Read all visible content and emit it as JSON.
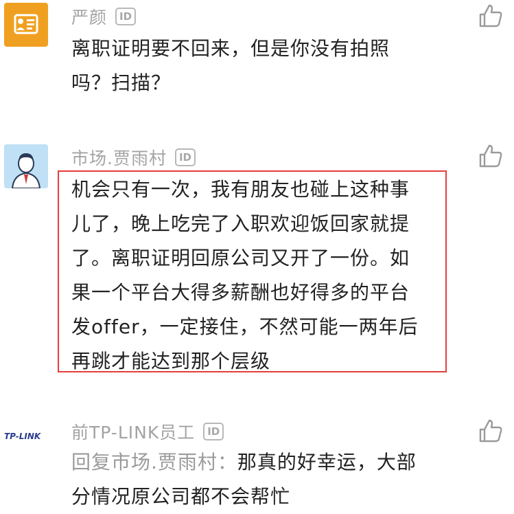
{
  "colors": {
    "accent_orange": "#f0a020",
    "highlight_red": "#e53b3b",
    "username_gray": "#a3a3a3",
    "text_dark": "#222222"
  },
  "comments": [
    {
      "username": "严颜",
      "badge": "ID",
      "avatar_icon": "contact-card-icon",
      "lines": [
        "离职证明要不回来，但是你没有拍照",
        "吗？扫描？"
      ]
    },
    {
      "username": "市场.贾雨村",
      "badge": "ID",
      "avatar_icon": "businessman-avatar-icon",
      "lines": [
        "机会只有一次，我有朋友也碰上这种事",
        "儿了，晚上吃完了入职欢迎饭回家就提",
        "了。离职证明回原公司又开了一份。如",
        "果一个平台大得多薪酬也好得多的平台",
        "发offer，一定接住，不然可能一两年后",
        "再跳才能达到那个层级"
      ]
    },
    {
      "username": "前TP-LINK员工",
      "badge": "ID",
      "avatar_logo_text": "TP-LINK",
      "reply_prefix": "回复市场.贾雨村：",
      "lines": [
        "那真的好幸运，大部",
        "分情况原公司都不会帮忙"
      ]
    }
  ]
}
